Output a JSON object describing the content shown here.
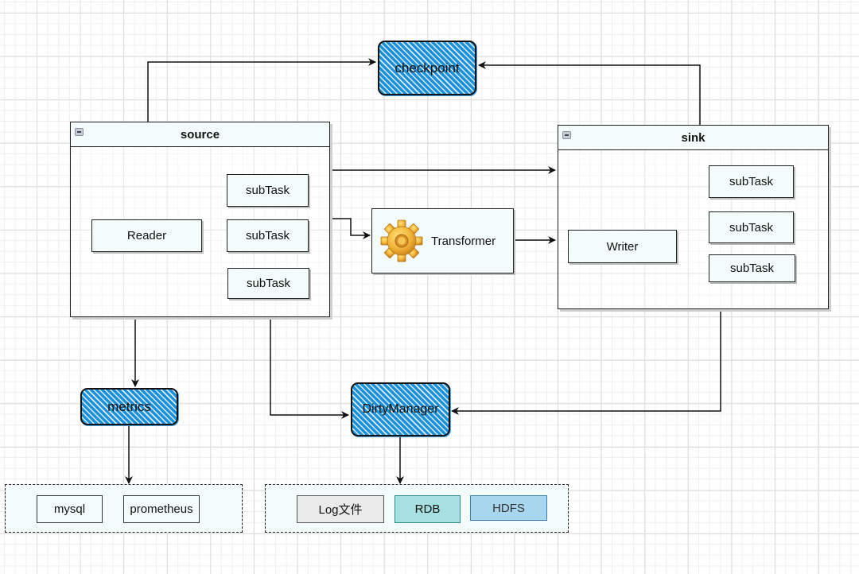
{
  "diagram": {
    "checkpoint": {
      "label": "checkpoint",
      "fill": "#1e90d8"
    },
    "source": {
      "title": "source",
      "reader": "Reader",
      "subtasks": [
        "subTask",
        "subTask",
        "subTask"
      ]
    },
    "transformer": {
      "label": "Transformer",
      "icon": "gear-icon"
    },
    "sink": {
      "title": "sink",
      "writer": "Writer",
      "subtasks": [
        "subTask",
        "subTask",
        "subTask"
      ]
    },
    "metrics": {
      "label": "metrics",
      "fill": "#1e90d8"
    },
    "dirty_manager": {
      "label": "DirtyManager",
      "fill": "#1e90d8"
    },
    "metrics_targets": [
      {
        "label": "mysql",
        "fill": "#f4fbfb"
      },
      {
        "label": "prometheus",
        "fill": "#f4fbfb"
      }
    ],
    "dirty_targets": [
      {
        "label": "Log文件",
        "fill": "#eaeaea",
        "border": "#555555"
      },
      {
        "label": "RDB",
        "fill": "#a6e0e0",
        "border": "#2a8a8a"
      },
      {
        "label": "HDFS",
        "fill": "#a9d6ef",
        "border": "#3a7fb0"
      }
    ],
    "edges": [
      {
        "from": "source",
        "to": "checkpoint"
      },
      {
        "from": "sink",
        "to": "checkpoint"
      },
      {
        "from": "source",
        "to": "sink"
      },
      {
        "from": "source",
        "to": "transformer"
      },
      {
        "from": "transformer",
        "to": "sink"
      },
      {
        "from": "source",
        "to": "metrics"
      },
      {
        "from": "source",
        "to": "dirty_manager"
      },
      {
        "from": "sink",
        "to": "dirty_manager"
      },
      {
        "from": "metrics",
        "to": "metrics_targets"
      },
      {
        "from": "dirty_manager",
        "to": "dirty_targets"
      }
    ]
  }
}
